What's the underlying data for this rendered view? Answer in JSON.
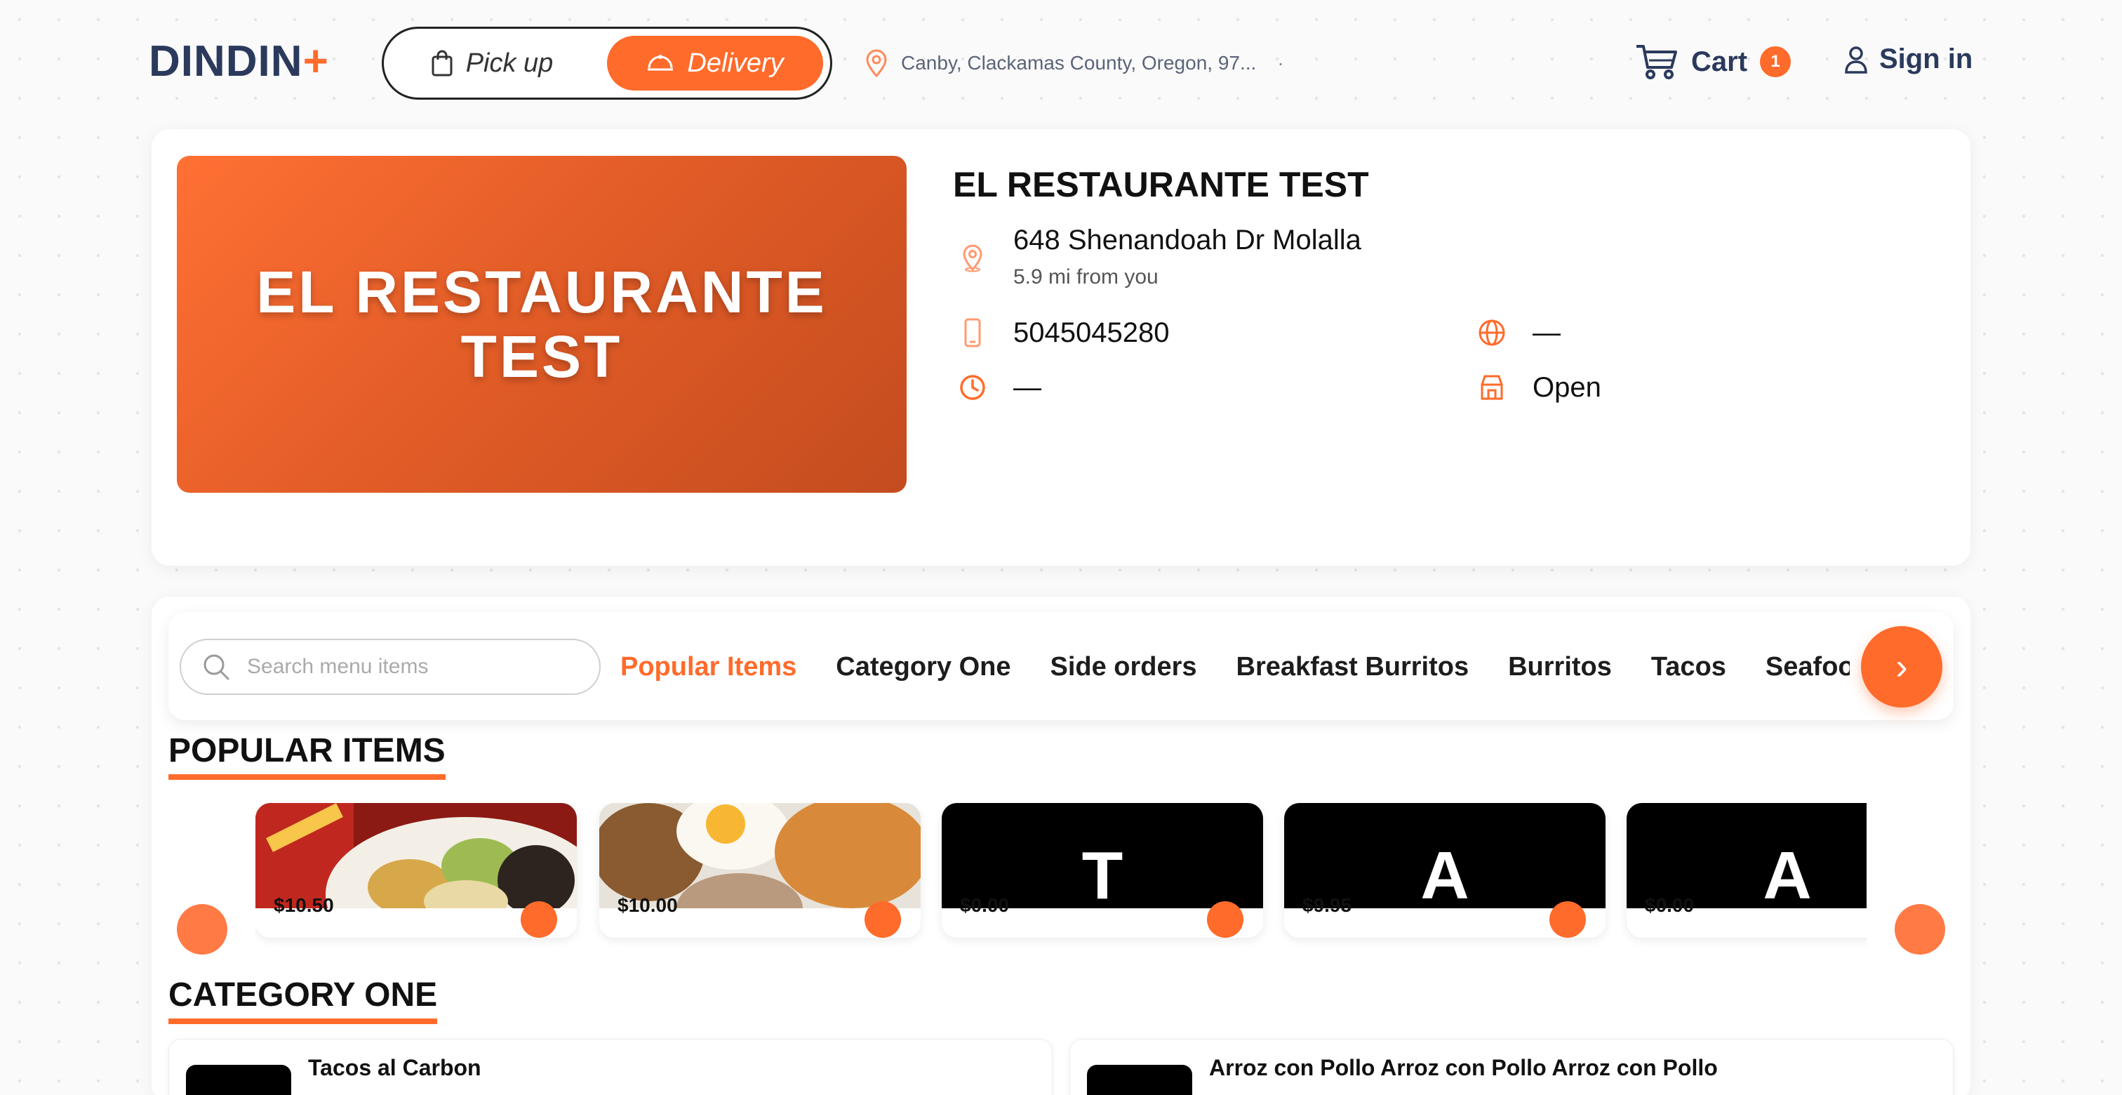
{
  "brand": {
    "name": "DINDIN",
    "plus": "+"
  },
  "mode": {
    "pickup": "Pick up",
    "delivery": "Delivery",
    "selected": "delivery"
  },
  "location": {
    "text": "Canby, Clackamas County, Oregon, 97...",
    "separator": "·"
  },
  "header": {
    "cart_label": "Cart",
    "cart_count": "1",
    "signin_label": "Sign in"
  },
  "restaurant": {
    "banner_text": "EL RESTAURANTE TEST",
    "name": "EL RESTAURANTE TEST",
    "address": "648 Shenandoah Dr Molalla",
    "distance": "5.9 mi from you",
    "phone": "5045045280",
    "website": "—",
    "hours": "—",
    "status": "Open"
  },
  "menu": {
    "search_placeholder": "Search menu items",
    "categories": [
      "Popular Items",
      "Category One",
      "Side orders",
      "Breakfast Burritos",
      "Burritos",
      "Tacos",
      "Seafood"
    ],
    "active_category": "Popular Items",
    "next_arrow": "›"
  },
  "sections": {
    "popular": "POPULAR ITEMS",
    "category_one": "CATEGORY ONE"
  },
  "popular_items": [
    {
      "price": "$10.50",
      "image": "photo"
    },
    {
      "price": "$10.00",
      "image": "photo"
    },
    {
      "price": "$0.00",
      "letter": "T"
    },
    {
      "price": "$9.95",
      "letter": "A"
    },
    {
      "price": "$0.00",
      "letter": "A"
    }
  ],
  "category_one_items": [
    {
      "name": "Tacos al Carbon",
      "desc": ""
    },
    {
      "name": "Arroz con Pollo Arroz con Pollo Arroz con Pollo",
      "desc": ""
    }
  ],
  "colors": {
    "accent": "#ff6b2b",
    "brand_navy": "#2b3a5c"
  }
}
